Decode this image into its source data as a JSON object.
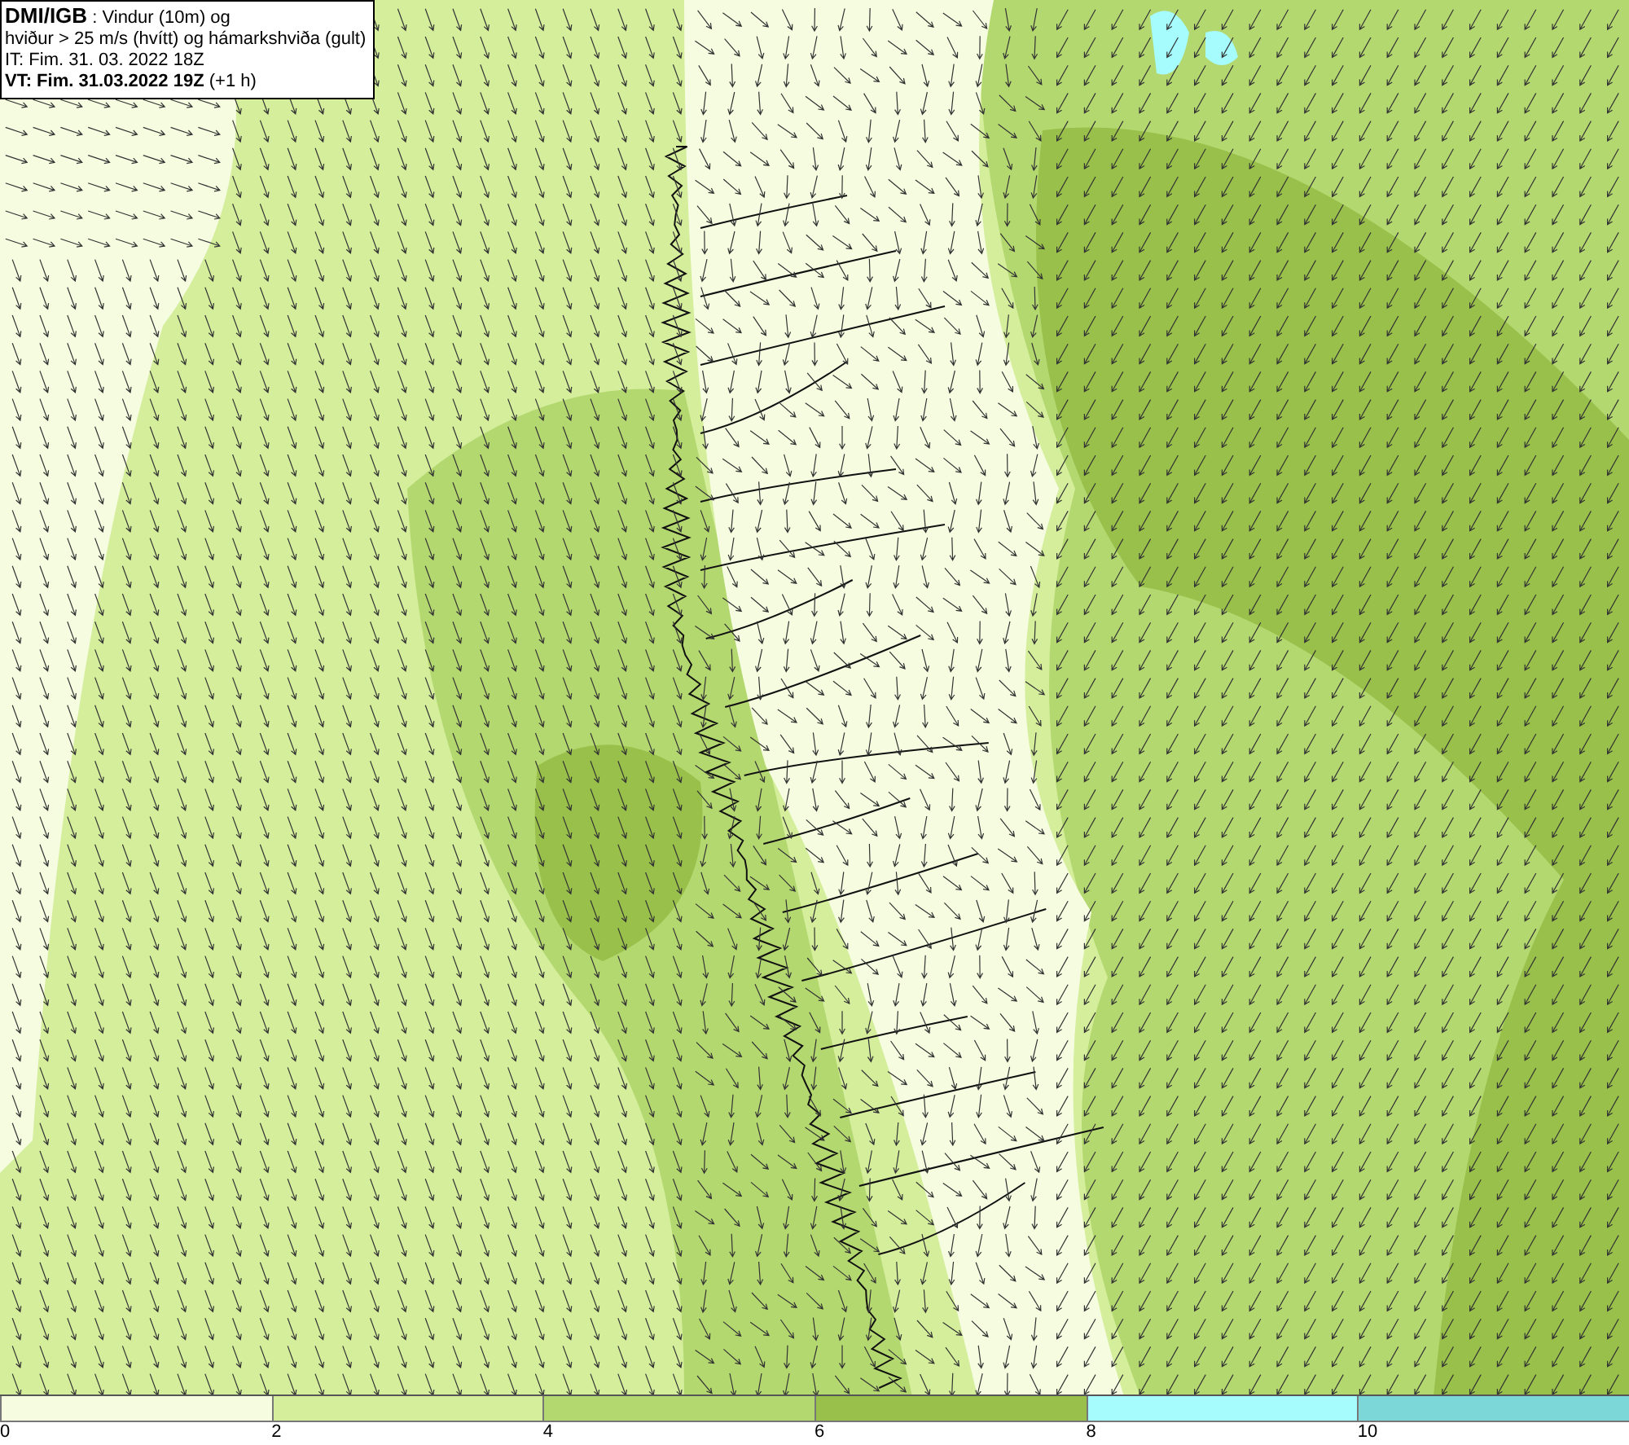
{
  "info_box": {
    "lines": [
      "**DMI/IGB** : Vindur (10m) og",
      "hviður > 25 m/s (hvítt) og hámarkshviða (gult)",
      "IT: Fim. 31. 03. 2022 18Z",
      "**VT: Fim. 31.03.2022 19Z** (+1 h)"
    ]
  },
  "legend": [
    {
      "label": "0",
      "color": "#f5fce0"
    },
    {
      "label": "2",
      "color": "#d4ee9c"
    },
    {
      "label": "4",
      "color": "#b4d870"
    },
    {
      "label": "6",
      "color": "#98c04a"
    },
    {
      "label": "8",
      "color": "#a6fbfc"
    },
    {
      "label": "10",
      "color": "#7cd8d8"
    }
  ]
}
